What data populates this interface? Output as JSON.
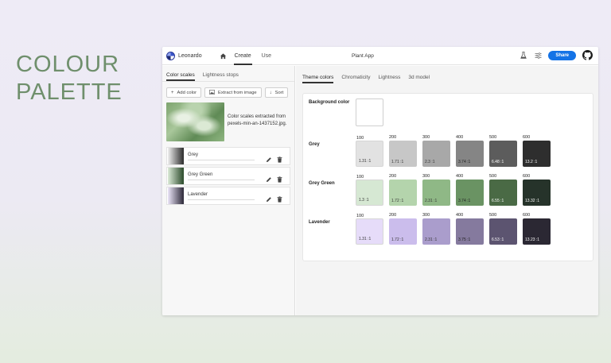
{
  "hero": {
    "line1": "COLOUR",
    "line2": "PALETTE"
  },
  "topbar": {
    "app_name": "Leonardo",
    "nav": {
      "create": "Create",
      "use": "Use"
    },
    "project_title": "Plant App",
    "share_label": "Share",
    "icons": {
      "logo": "leonardo-logo",
      "home": "home-icon",
      "flask": "flask-icon",
      "settings": "sliders-icon",
      "github": "github-icon"
    }
  },
  "left": {
    "tabs": [
      "Color scales",
      "Lightness stops"
    ],
    "actions": {
      "add": "Add color",
      "extract": "Extract from image",
      "sort": "Sort"
    },
    "image_caption": "Color scales extracted from pexels-min-an-1437152.jpg.",
    "scales": [
      {
        "name": "Grey",
        "swatch_from": "#f0f0f0",
        "swatch_to": "#2b2b2b"
      },
      {
        "name": "Grey Green",
        "swatch_from": "#dcebd8",
        "swatch_to": "#2a4a2a"
      },
      {
        "name": "Lavender",
        "swatch_from": "#ece6f9",
        "swatch_to": "#2c2838"
      }
    ]
  },
  "right": {
    "tabs": [
      "Theme colors",
      "Chromaticity",
      "Lightness",
      "3d model"
    ],
    "background_label": "Background color",
    "background_color": "#ffffff",
    "rows": [
      {
        "name": "Grey",
        "chips": [
          {
            "step": "100",
            "ratio": "1.31 :1",
            "color": "#e2e2e2",
            "text": "#333333"
          },
          {
            "step": "200",
            "ratio": "1.71 :1",
            "color": "#c7c7c7",
            "text": "#333333"
          },
          {
            "step": "300",
            "ratio": "2.3 :1",
            "color": "#a8a8a8",
            "text": "#333333"
          },
          {
            "step": "400",
            "ratio": "3.74 :1",
            "color": "#858585",
            "text": "#222222"
          },
          {
            "step": "500",
            "ratio": "6.48 :1",
            "color": "#5c5c5c",
            "text": "#ffffff"
          },
          {
            "step": "600",
            "ratio": "13.2 :1",
            "color": "#2e2e2e",
            "text": "#ffffff"
          }
        ]
      },
      {
        "name": "Grey Green",
        "chips": [
          {
            "step": "100",
            "ratio": "1.3 :1",
            "color": "#d6e8d3",
            "text": "#333333"
          },
          {
            "step": "200",
            "ratio": "1.72 :1",
            "color": "#b4d4ac",
            "text": "#333333"
          },
          {
            "step": "300",
            "ratio": "2.31 :1",
            "color": "#8fb886",
            "text": "#333333"
          },
          {
            "step": "400",
            "ratio": "3.74 :1",
            "color": "#6a9363",
            "text": "#222222"
          },
          {
            "step": "500",
            "ratio": "6.55 :1",
            "color": "#4a6a45",
            "text": "#ffffff"
          },
          {
            "step": "600",
            "ratio": "13.32 :1",
            "color": "#26332a",
            "text": "#ffffff"
          }
        ]
      },
      {
        "name": "Lavender",
        "chips": [
          {
            "step": "100",
            "ratio": "1.31 :1",
            "color": "#e6dcf9",
            "text": "#333333"
          },
          {
            "step": "200",
            "ratio": "1.72 :1",
            "color": "#cbbdec",
            "text": "#333333"
          },
          {
            "step": "300",
            "ratio": "2.31 :1",
            "color": "#aa9dcc",
            "text": "#333333"
          },
          {
            "step": "400",
            "ratio": "3.75 :1",
            "color": "#857a9e",
            "text": "#222222"
          },
          {
            "step": "500",
            "ratio": "6.53 :1",
            "color": "#5c5470",
            "text": "#ffffff"
          },
          {
            "step": "600",
            "ratio": "13.23 :1",
            "color": "#2b2833",
            "text": "#ffffff"
          }
        ]
      }
    ]
  }
}
